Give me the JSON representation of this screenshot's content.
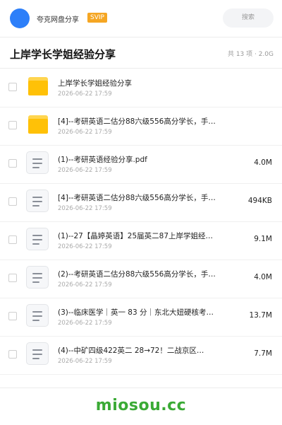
{
  "topbar": {
    "username": "夸克网盘分享",
    "badge": "SVIP",
    "search_placeholder": "搜索"
  },
  "header": {
    "title": "上岸学长学姐经验分享",
    "meta": "共 13 项 · 2.0G"
  },
  "items": [
    {
      "type": "folder",
      "name": "上岸学长学姐经验分享",
      "date": "2026-06-22 17:59",
      "size": ""
    },
    {
      "type": "folder",
      "name": "[4]--考研英语二估分88六级556高分学长，手…",
      "date": "2026-06-22 17:59",
      "size": ""
    },
    {
      "type": "file",
      "name": "(1)--考研英语经验分享.pdf",
      "date": "2026-06-22 17:59",
      "size": "4.0M"
    },
    {
      "type": "file",
      "name": "[4]--考研英语二估分88六级556高分学长，手…",
      "date": "2026-06-22 17:59",
      "size": "494KB"
    },
    {
      "type": "file",
      "name": "(1)--27【晶婷英语】25届英二87上岸学姐经…",
      "date": "2026-06-22 17:59",
      "size": "9.1M"
    },
    {
      "type": "file",
      "name": "(2)--考研英语二估分88六级556高分学长，手…",
      "date": "2026-06-22 17:59",
      "size": "4.0M"
    },
    {
      "type": "file",
      "name": "(3)--临床医学｜英一 83 分｜东北大妞硬核考…",
      "date": "2026-06-22 17:59",
      "size": "13.7M"
    },
    {
      "type": "file",
      "name": "(4)--中矿四级422英二 28→72！二战京区…",
      "date": "2026-06-22 17:59",
      "size": "7.7M"
    }
  ],
  "footer": {
    "brand": "miosou.cc"
  }
}
